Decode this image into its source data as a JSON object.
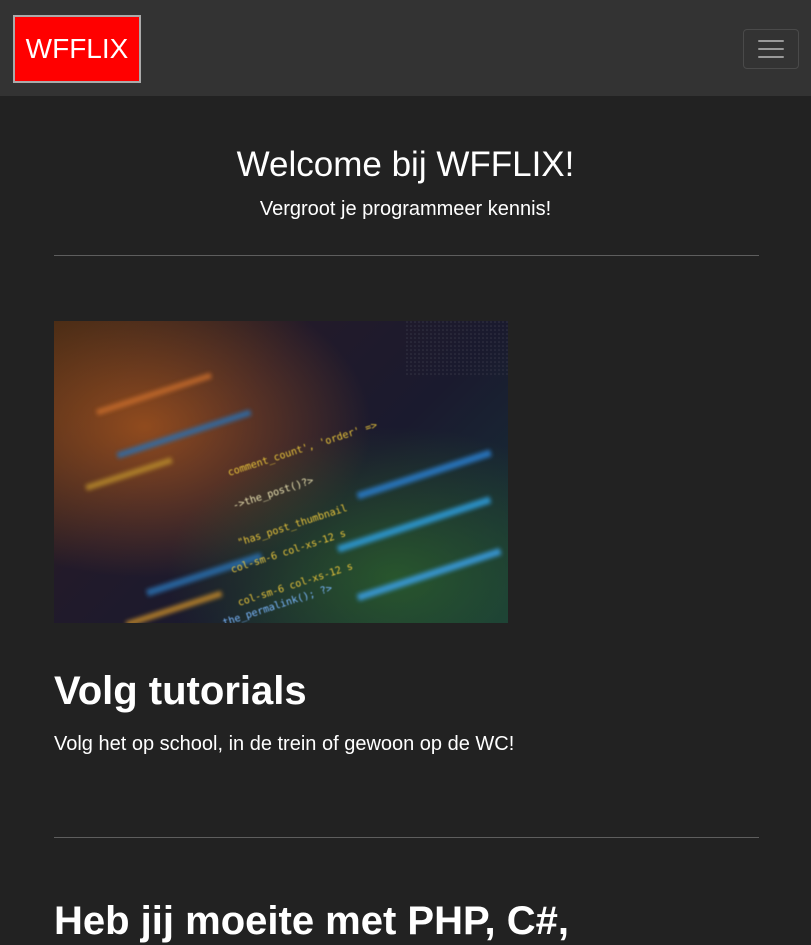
{
  "navbar": {
    "logo_text": "WFFLIX",
    "logo_bg": "#ff0000",
    "toggler_icon": "hamburger-menu-icon"
  },
  "hero": {
    "title": "Welcome bij WFFLIX!",
    "subtitle": "Vergroot je programmeer kennis!"
  },
  "feature": {
    "image_icon": "code-screen-image",
    "title": "Volg tutorials",
    "text": "Volg het op school, in de trein of gewoon op de WC!"
  },
  "next_section": {
    "title": "Heb jij moeite met PHP, C#,"
  },
  "colors": {
    "page_bg": "#222222",
    "navbar_bg": "#333333",
    "accent": "#ff0000"
  }
}
